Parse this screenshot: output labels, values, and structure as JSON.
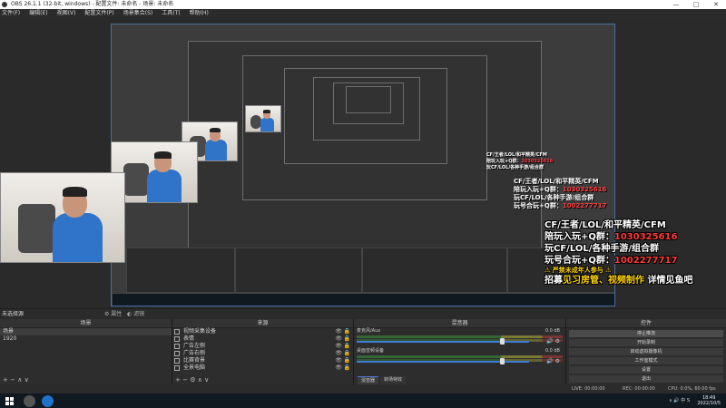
{
  "window": {
    "title": "OBS 26.1.1 (32-bit, windows) - 配置文件: 未命名 - 场景: 未命名"
  },
  "menu": [
    "文件(F)",
    "编辑(E)",
    "视图(V)",
    "配置文件(P)",
    "场景集合(S)",
    "工具(T)",
    "帮助(H)"
  ],
  "window_controls": {
    "minimize": "—",
    "maximize": "□",
    "close": "✕"
  },
  "overlay": {
    "line1": "CF/王者/LOL/和平精英/CFM",
    "line2_prefix": "陪玩入玩+Q群：",
    "line2_number": "1030325616",
    "line3": "玩CF/LOL/各种手游/组合群",
    "line4_prefix": "玩号合玩+Q群：",
    "line4_number": "1002277717",
    "line5": "⚠ 严禁未成年人参与 ⚠",
    "line6_a": "招募",
    "line6_b": "见习房管、视频制作",
    "line6_c": "详情见鱼吧"
  },
  "statusbar": {
    "scene_label": "未选择源",
    "properties": "属性",
    "filters": "滤镜"
  },
  "scenes": {
    "header": "场景",
    "items": [
      "场景",
      "1920"
    ]
  },
  "sources": {
    "header": "来源",
    "items": [
      "视频采集设备",
      "表情",
      "广告左侧",
      "广告右侧",
      "比赛背景",
      "全景电脑"
    ]
  },
  "mixer": {
    "header": "混音器",
    "channels": [
      {
        "name": "麦克风/Aux",
        "db": "0.0 dB",
        "level": 0.84
      },
      {
        "name": "桌面音频设备",
        "db": "0.0 dB",
        "level": 0.84
      }
    ],
    "tabs": [
      "混音器",
      "转场特效"
    ]
  },
  "controls": {
    "header": "控件",
    "buttons": [
      "停止推流",
      "开始录制",
      "启动虚拟摄像机",
      "工作室模式",
      "设置",
      "退出"
    ]
  },
  "obs_status": {
    "live": "LIVE: 00:00:00",
    "rec": "REC: 00:00:00",
    "cpu": "CPU: 0.0%, 60.00 fps"
  },
  "footer_glyphs": {
    "add": "+",
    "remove": "−",
    "up": "∧",
    "down": "∨",
    "gear": "⚙"
  },
  "taskbar": {
    "tray": "∧ 🔊 中 S",
    "time": "18:49",
    "date": "2022/10/5"
  },
  "colors": {
    "accent": "#3d7bd6",
    "overlay_red": "#ff3b3b",
    "overlay_yellow": "#ffd400"
  }
}
